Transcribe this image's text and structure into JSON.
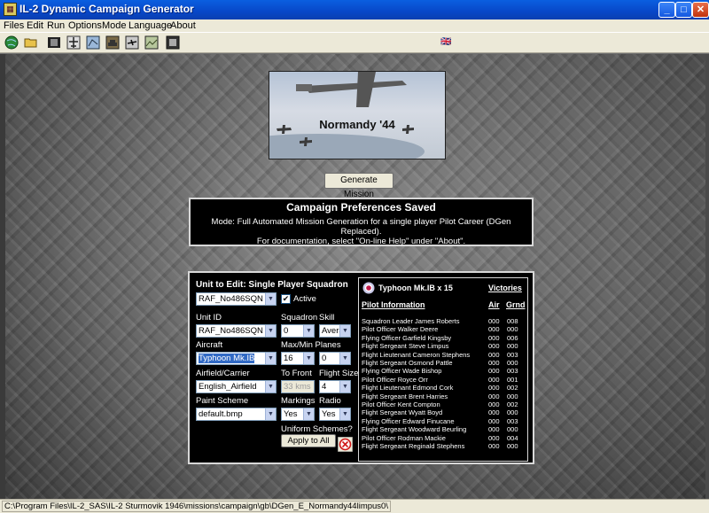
{
  "window": {
    "title": "IL-2 Dynamic Campaign Generator",
    "app_icon": "il2-app-icon",
    "controls": {
      "minimize": "_",
      "maximize": "□",
      "close": "✕"
    }
  },
  "menu": [
    "Files",
    "Edit",
    "Run",
    "Options",
    "Mode",
    "Language",
    "About"
  ],
  "toolbar": {
    "icons": [
      "globe-icon",
      "open-folder-icon",
      "film-icon",
      "aircraft-icon",
      "map-icon",
      "tank-icon",
      "plane-silhouette-icon",
      "landscape-icon",
      "camera-icon",
      "flag-icon"
    ],
    "flag_glyph": "🇬🇧"
  },
  "banner": {
    "title": "Normandy '44"
  },
  "generate_button": "Generate Mission",
  "prefs": {
    "heading": "Campaign Preferences Saved",
    "line1": "Mode: Full Automated Mission Generation for a single player Pilot Career (DGen Replaced).",
    "line2": "For documentation, select \"On-line Help\" under \"About\"."
  },
  "unit_editor": {
    "heading": "Unit to Edit: Single Player Squadron",
    "unit_select": "RAF_No486SQN",
    "active_label": "Active",
    "active_checked": true,
    "labels": {
      "unit_id": "Unit ID",
      "squadron": "Squadron",
      "skill": "Skill",
      "aircraft": "Aircraft",
      "maxmin": "Max/Min Planes",
      "airfield": "Airfield/Carrier",
      "to_front": "To Front",
      "flight_size": "Flight Size",
      "paint": "Paint Scheme",
      "markings": "Markings",
      "radio": "Radio",
      "uniform": "Uniform Schemes?"
    },
    "values": {
      "unit_id": "RAF_No486SQN",
      "squadron": "0",
      "skill": "Avera",
      "aircraft": "Typhoon Mk.IB",
      "max_planes": "16",
      "min_planes": "0",
      "airfield": "English_Airfield",
      "to_front": "33 kms",
      "flight_size": "4",
      "paint": "default.bmp",
      "markings": "Yes",
      "radio": "Yes"
    },
    "apply_all": "Apply to All",
    "cancel_icon": "cancel-circle-icon"
  },
  "roster": {
    "aircraft": "Typhoon Mk.IB x 15",
    "victories": "Victories",
    "pilot_info": "Pilot Information",
    "air": "Air",
    "grnd": "Grnd",
    "pilots": [
      {
        "name": "Squadron Leader James Roberts",
        "air": "000",
        "grnd": "008"
      },
      {
        "name": "Pilot Officer Walker Deere",
        "air": "000",
        "grnd": "000"
      },
      {
        "name": "Flying Officer Garfield Kingsby",
        "air": "000",
        "grnd": "006"
      },
      {
        "name": "Flight Sergeant Steve Limpus",
        "air": "000",
        "grnd": "000"
      },
      {
        "name": "Flight Lieutenant Cameron Stephens",
        "air": "000",
        "grnd": "003"
      },
      {
        "name": "Flight Sergeant Osmond Pattle",
        "air": "000",
        "grnd": "000"
      },
      {
        "name": "Flying Officer Wade Bishop",
        "air": "000",
        "grnd": "003"
      },
      {
        "name": "Pilot Officer Royce Orr",
        "air": "000",
        "grnd": "001"
      },
      {
        "name": "Flight Lieutenant Edmond Cork",
        "air": "000",
        "grnd": "002"
      },
      {
        "name": "Flight Sergeant Brent Harries",
        "air": "000",
        "grnd": "000"
      },
      {
        "name": "Pilot Officer Kent Compton",
        "air": "000",
        "grnd": "002"
      },
      {
        "name": "Flight Sergeant Wyatt Boyd",
        "air": "000",
        "grnd": "000"
      },
      {
        "name": "Flying Officer Edward Finucane",
        "air": "000",
        "grnd": "003"
      },
      {
        "name": "Flight Sergeant Woodward Beurling",
        "air": "000",
        "grnd": "000"
      },
      {
        "name": "Pilot Officer Rodman Mackie",
        "air": "000",
        "grnd": "004"
      },
      {
        "name": "Flight Sergeant Reginald Stephens",
        "air": "000",
        "grnd": "000"
      }
    ]
  },
  "status": "C:\\Program Files\\IL-2_SAS\\IL-2 Sturmovik 1946\\missions\\campaign\\gb\\DGen_E_Normandy44limpus0\\"
}
